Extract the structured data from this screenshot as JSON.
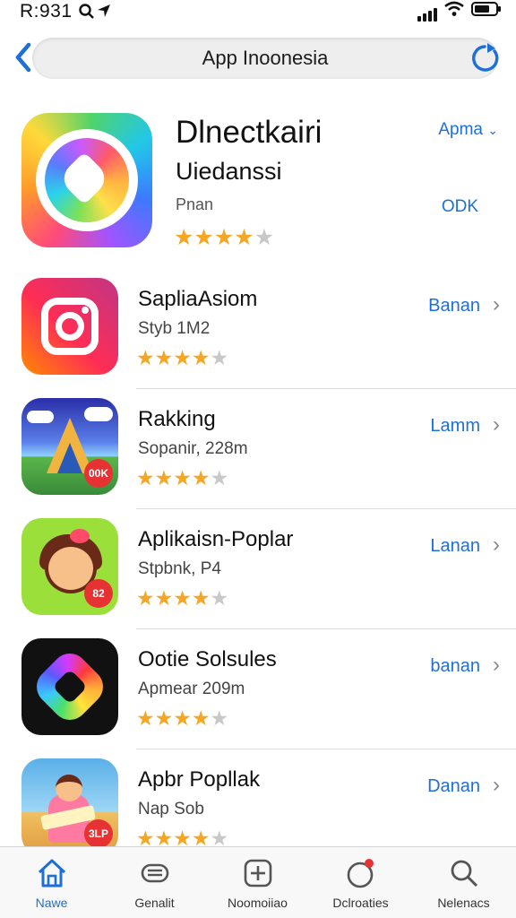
{
  "status_bar": {
    "time": "R:931"
  },
  "header": {
    "title": "App Inoonesia"
  },
  "featured": {
    "name": "Dlnectkairi",
    "subtitle": "Uiedanssi",
    "category": "Pnan",
    "action": "Apma",
    "action_secondary": "ODK",
    "rating": 4
  },
  "apps": [
    {
      "name": "SapliaAsiom",
      "meta": "Styb 1M2",
      "action": "Banan",
      "rating": 4,
      "icon": "camera-icon"
    },
    {
      "name": "Rakking",
      "meta": "Sopanir, 228m",
      "action": "Lamm",
      "rating": 4,
      "icon": "tower-game-icon",
      "badge": "00K"
    },
    {
      "name": "Aplikaisn-Poplar",
      "meta": "Stpbnk, P4",
      "action": "Lanan",
      "rating": 4,
      "icon": "girl-character-icon",
      "badge": "82"
    },
    {
      "name": "Ootie Solsules",
      "meta": "Apmear 209m",
      "action": "banan",
      "rating": 4,
      "icon": "colorful-shape-icon"
    },
    {
      "name": "Apbr Popllak",
      "meta": "Nap Sob",
      "action": "Danan",
      "rating": 4,
      "icon": "kid-reading-icon",
      "badge": "3LP"
    }
  ],
  "tabs": [
    {
      "label": "Nawe",
      "icon": "home-icon",
      "active": true
    },
    {
      "label": "Genalit",
      "icon": "games-icon",
      "active": false
    },
    {
      "label": "Noomoiiao",
      "icon": "apps-icon",
      "active": false
    },
    {
      "label": "Dclroaties",
      "icon": "updates-icon",
      "active": false
    },
    {
      "label": "Nelenacs",
      "icon": "search-icon",
      "active": false
    }
  ],
  "colors": {
    "accent": "#1e6fd6",
    "star": "#f5a623",
    "badge": "#e63232"
  }
}
